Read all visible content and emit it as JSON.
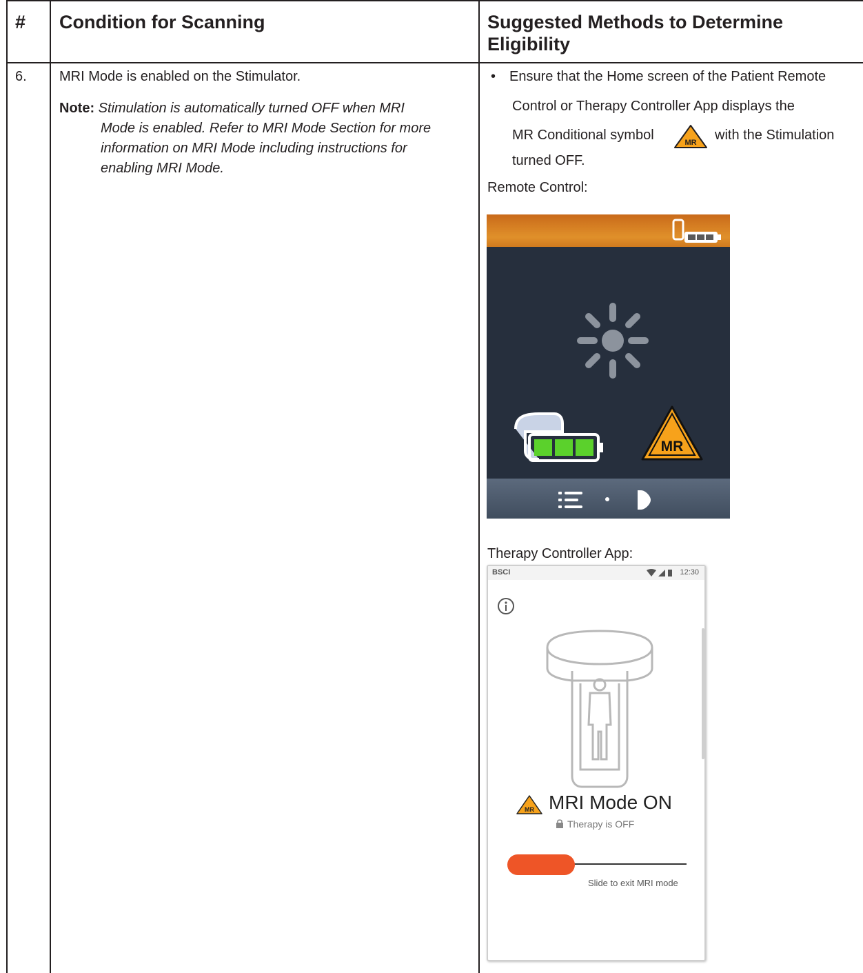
{
  "table": {
    "headers": {
      "number": "#",
      "condition": "Condition for Scanning",
      "methods_line1": "Suggested Methods to Determine",
      "methods_line2": "Eligibility"
    },
    "row": {
      "number": "6.",
      "condition": "MRI Mode is enabled on the Stimulator.",
      "note_label": "Note:",
      "note_lines": [
        "Stimulation is automatically turned OFF when MRI",
        "Mode is enabled. Refer to MRI Mode Section for more",
        "information on MRI Mode including instructions for",
        "enabling MRI Mode."
      ],
      "bullet": "•",
      "method_lines": [
        "Ensure that the Home screen of the Patient Remote",
        "Control or Therapy Controller App displays the",
        "MR Conditional symbol",
        "with the Stimulation",
        "turned OFF."
      ],
      "remote_caption": "Remote Control:",
      "app_caption": "Therapy Controller App:"
    }
  },
  "remote_control": {
    "badge_text": "MR",
    "colors": {
      "screen": "#262f3d",
      "accent": "#e0902a",
      "battery": "#5bd12c"
    },
    "icons": [
      "remote-battery-icon",
      "stimulation-off-icon",
      "ipg-battery-icon",
      "mr-conditional-icon",
      "menu-icon",
      "next-icon"
    ]
  },
  "app": {
    "carrier": "BSCI",
    "time": "12:30",
    "badge_text": "MR",
    "mode_title": "MRI Mode ON",
    "therapy_status": "Therapy is OFF",
    "slide_label": "Slide to exit MRI mode",
    "colors": {
      "slider": "#ee5527",
      "warning": "#f7a21b"
    }
  }
}
